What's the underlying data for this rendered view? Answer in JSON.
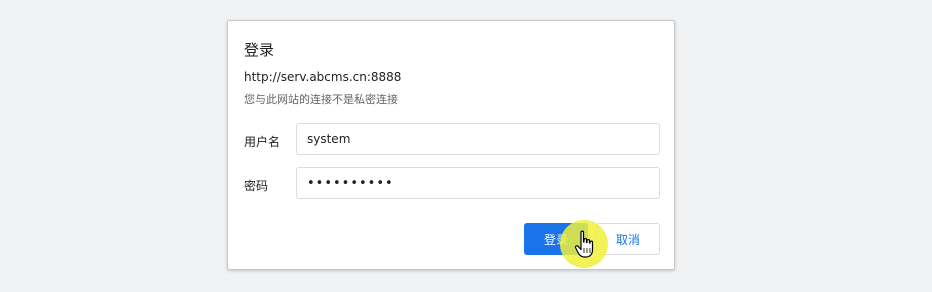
{
  "dialog": {
    "title": "登录",
    "url": "http://serv.abcms.cn:8888",
    "warning": "您与此网站的连接不是私密连接",
    "username_label": "用户名",
    "username_value": "system",
    "password_label": "密码",
    "password_value": "••••••••••",
    "login_button": "登录",
    "cancel_button": "取消"
  },
  "cursor": {
    "icon": "hand-pointer-icon",
    "highlight_color": "#f0f03c"
  },
  "colors": {
    "accent": "#1a73e8",
    "background": "#f1f2f4"
  }
}
